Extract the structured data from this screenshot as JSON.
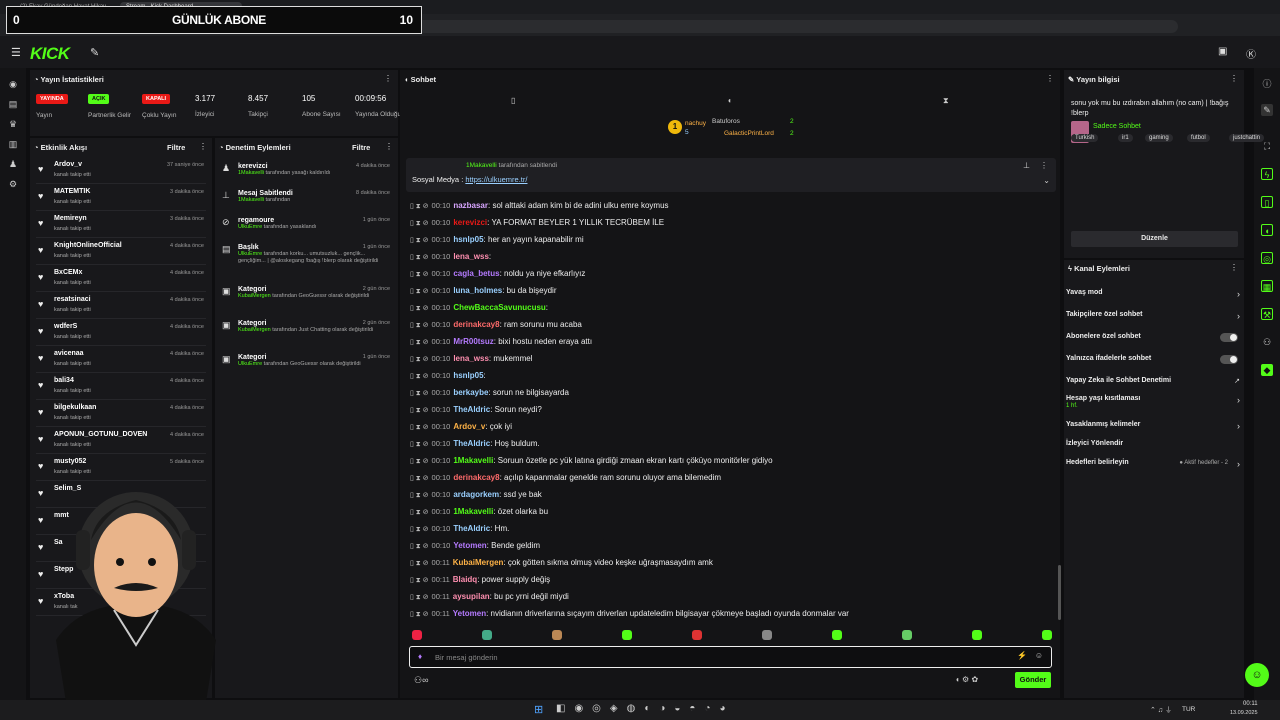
{
  "browser": {
    "tab1": "(2) Ekay Gündoğan Hayat Hikay...",
    "tab2": "Stream - Kick Dashboard",
    "url": "https://dashboard.kick.com/stream"
  },
  "overlay": {
    "left": "0",
    "title": "GÜNLÜK ABONE",
    "right": "10"
  },
  "brand": {
    "logo": "KICK",
    "accent": "#53fc18"
  },
  "stats": {
    "title": "Yayın İstatistikleri",
    "items": [
      {
        "badge": "YAYINDA",
        "label": "Yayın",
        "color": "#e91916"
      },
      {
        "badge": "AÇIK",
        "label": "Partnerlik Gelir",
        "color": "#53fc18"
      },
      {
        "badge": "KAPALI",
        "label": "Çoklu Yayın",
        "color": "#e91916"
      },
      {
        "value": "3.177",
        "label": "İzleyici"
      },
      {
        "value": "8.457",
        "label": "Takipçi"
      },
      {
        "value": "105",
        "label": "Abone Sayısı"
      },
      {
        "value": "00:09:56",
        "label": "Yayında Olduğu"
      }
    ]
  },
  "activity": {
    "title": "Etkinlik Akışı",
    "filter": "Filtre",
    "items": [
      {
        "name": "Ardov_v",
        "sub": "kanalı takip etti",
        "time": "37 saniye önce"
      },
      {
        "name": "MATEMTIK",
        "sub": "kanalı takip etti",
        "time": "3 dakika önce"
      },
      {
        "name": "Memireyn",
        "sub": "kanalı takip etti",
        "time": "3 dakika önce"
      },
      {
        "name": "KnightOnlineOfficial",
        "sub": "kanalı takip etti",
        "time": "4 dakika önce"
      },
      {
        "name": "BxCEMx",
        "sub": "kanalı takip etti",
        "time": "4 dakika önce"
      },
      {
        "name": "resatsinaci",
        "sub": "kanalı takip etti",
        "time": "4 dakika önce"
      },
      {
        "name": "wdferS",
        "sub": "kanalı takip etti",
        "time": "4 dakika önce"
      },
      {
        "name": "avicenaa",
        "sub": "kanalı takip etti",
        "time": "4 dakika önce"
      },
      {
        "name": "bali34",
        "sub": "kanalı takip etti",
        "time": "4 dakika önce"
      },
      {
        "name": "bilgekulkaan",
        "sub": "kanalı takip etti",
        "time": "4 dakika önce"
      },
      {
        "name": "APONUN_GOTUNU_DOVEN",
        "sub": "kanalı takip etti",
        "time": "4 dakika önce"
      },
      {
        "name": "musty052",
        "sub": "kanalı takip etti",
        "time": "5 dakika önce"
      },
      {
        "name": "Selim_S",
        "sub": "",
        "time": ""
      },
      {
        "name": "mmt",
        "sub": "",
        "time": ""
      },
      {
        "name": "Sa",
        "sub": "",
        "time": ""
      },
      {
        "name": "Stepp",
        "sub": "",
        "time": ""
      },
      {
        "name": "xToba",
        "sub": "kanalı tak",
        "time": ""
      }
    ]
  },
  "moderation": {
    "title": "Denetim Eylemleri",
    "filter": "Filtre",
    "items": [
      {
        "name": "kerevizci",
        "sub1": "1Makavelli",
        "sub2": " tarafından yasağı kaldırıldı",
        "time": "4 dakika önce"
      },
      {
        "name": "Mesaj Sabitlendi",
        "sub1": "1Makavelli",
        "sub2": " tarafından",
        "time": "8 dakika önce"
      },
      {
        "name": "regamoure",
        "sub1": "UlkuEmre",
        "sub2": " tarafından yasaklandı",
        "time": "1 gün önce"
      },
      {
        "name": "Başlık",
        "sub1": "UlkuEmre",
        "sub2": " tarafından korku... umutsuzluk... gençlik... gençliğim... | @aloskegang !bağış !blerp olarak değiştirildi",
        "time": "1 gün önce"
      },
      {
        "name": "Kategori",
        "sub1": "KubaiMergen",
        "sub2": " tarafından GeoGuessr olarak değiştirildi",
        "time": "2 gün önce"
      },
      {
        "name": "Kategori",
        "sub1": "KubaiMergen",
        "sub2": " tarafından Just Chatting olarak değiştirildi",
        "time": "2 gün önce"
      },
      {
        "name": "Kategori",
        "sub1": "UlkuEmre",
        "sub2": " tarafından GeoGuessr olarak değiştirildi",
        "time": "1 gün önce"
      }
    ]
  },
  "chat": {
    "title": "Sohbet",
    "top_users": [
      {
        "name": "nachuy",
        "count": "5"
      },
      {
        "name": "Batuforos",
        "count": "2"
      },
      {
        "name": "GalacticPrintLord",
        "count": "2"
      }
    ],
    "pinned_user": "1Makavelli",
    "pinned_by": "tarafından sabitlendi",
    "pinned_text": "Sosyal Medya : ",
    "pinned_link": "https://ulkuemre.tr/",
    "input_placeholder": "Bir mesaj gönderin",
    "send": "Gönder",
    "messages": [
      {
        "t": "00:10",
        "u": "nazbasar",
        "c": "#d8a6ff",
        "m": "sol alttaki adam kim bi de adini ulku emre koymus"
      },
      {
        "t": "00:10",
        "u": "kerevizci",
        "c": "#e91916",
        "m": "YA FORMAT BEYLER 1 YILLIK TECRÜBEM İLE"
      },
      {
        "t": "00:10",
        "u": "hsnlp05",
        "c": "#9ad0ff",
        "m": "her an yayın kapanabilir mi"
      },
      {
        "t": "00:10",
        "u": "lena_wss",
        "c": "#ff8fb0",
        "m": ""
      },
      {
        "t": "00:10",
        "u": "cagla_betus",
        "c": "#b57bff",
        "m": "noldu ya niye efkarlıyız"
      },
      {
        "t": "00:10",
        "u": "luna_holmes",
        "c": "#9ad0ff",
        "m": "bu da bişeydir"
      },
      {
        "t": "00:10",
        "u": "ChewBaccaSavunucusu",
        "c": "#53fc18",
        "m": ""
      },
      {
        "t": "00:10",
        "u": "derinakcay8",
        "c": "#ff6b6b",
        "m": "ram sorunu mu acaba"
      },
      {
        "t": "00:10",
        "u": "MrR00tsuz",
        "c": "#b57bff",
        "m": "bixi hostu neden eraya attı"
      },
      {
        "t": "00:10",
        "u": "lena_wss",
        "c": "#ff8fb0",
        "m": "mukemmel"
      },
      {
        "t": "00:10",
        "u": "hsnlp05",
        "c": "#9ad0ff",
        "m": ""
      },
      {
        "t": "00:10",
        "u": "berkaybe",
        "c": "#9ad0ff",
        "m": "sorun ne bilgisayarda"
      },
      {
        "t": "00:10",
        "u": "TheAldric",
        "c": "#9ad0ff",
        "m": "Sorun neydi?"
      },
      {
        "t": "00:10",
        "u": "Ardov_v",
        "c": "#ffb347",
        "m": "çok iyi"
      },
      {
        "t": "00:10",
        "u": "TheAldric",
        "c": "#9ad0ff",
        "m": "Hoş buldum."
      },
      {
        "t": "00:10",
        "u": "1Makavelli",
        "c": "#53fc18",
        "m": "Soruun özetle pc yük latına girdiği zmaan ekran kartı çöküyo monitörler gidiyo"
      },
      {
        "t": "00:10",
        "u": "derinakcay8",
        "c": "#ff6b6b",
        "m": "açılıp kapanmalar genelde ram sorunu oluyor ama bilemedim"
      },
      {
        "t": "00:10",
        "u": "ardagorkem",
        "c": "#9ad0ff",
        "m": "ssd ye bak"
      },
      {
        "t": "00:10",
        "u": "1Makavelli",
        "c": "#53fc18",
        "m": "özet olarka bu"
      },
      {
        "t": "00:10",
        "u": "TheAldric",
        "c": "#9ad0ff",
        "m": "Hm."
      },
      {
        "t": "00:10",
        "u": "Yetomen",
        "c": "#b57bff",
        "m": "Bende geldim"
      },
      {
        "t": "00:11",
        "u": "KubaiMergen",
        "c": "#ffb347",
        "m": "çok götten sıkma olmuş video keşke uğraşmasaydım amk"
      },
      {
        "t": "00:11",
        "u": "Blaidq",
        "c": "#ff8fb0",
        "m": "power supply değiş"
      },
      {
        "t": "00:11",
        "u": "aysupilan",
        "c": "#ff8fb0",
        "m": "bu pc yrni değil miydi"
      },
      {
        "t": "00:11",
        "u": "Yetomen",
        "c": "#b57bff",
        "m": "nvidianın driverlarına sıçayım driverlan updateledim bilgisayar çökmeye başladı oyunda donmalar var"
      }
    ]
  },
  "info": {
    "title": "Yayın bilgisi",
    "stream_title": "sonu yok mu bu ızdırabın allahım (no cam) | !bağış !blerp",
    "category": "Sadece Sohbet",
    "tags": [
      "Turkish",
      "ir1",
      "gaming",
      "futbol",
      "justchattin"
    ],
    "edit": "Düzenle"
  },
  "channel": {
    "title": "Kanal Eylemleri",
    "items": [
      {
        "label": "Yavaş mod",
        "type": "arrow"
      },
      {
        "label": "Takipçilere özel sohbet",
        "type": "arrow"
      },
      {
        "label": "Abonelere özel sohbet",
        "type": "toggle"
      },
      {
        "label": "Yalnızca ifadelerle sohbet",
        "type": "toggle"
      },
      {
        "label": "Yapay Zeka ile Sohbet Denetimi",
        "type": "ext"
      },
      {
        "label": "Hesap yaşı kısıtlaması",
        "sub": "1 hf.",
        "type": "arrow"
      },
      {
        "label": "Yasaklanmış kelimeler",
        "type": "arrow"
      },
      {
        "label": "İzleyici Yönlendir",
        "type": "none"
      },
      {
        "label": "Hedefleri belirleyin",
        "extra": "Aktif hedefler - 2",
        "type": "arrow"
      }
    ]
  },
  "taskbar": {
    "lang": "TUR",
    "time": "00:11",
    "date": "13.09.2025"
  }
}
